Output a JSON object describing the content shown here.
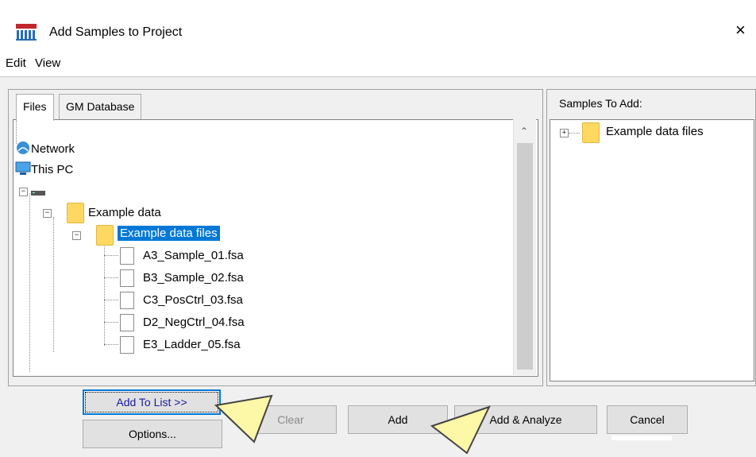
{
  "window": {
    "title": "Add Samples to Project",
    "close_glyph": "×",
    "icon": "gene-mapper-icon"
  },
  "menu": [
    {
      "label": "Edit"
    },
    {
      "label": "View"
    }
  ],
  "tabs": [
    {
      "label": "Files",
      "active": true
    },
    {
      "label": "GM Database",
      "active": false
    }
  ],
  "tree": {
    "network": "Network",
    "this_pc": "This PC",
    "folder1": "Example data",
    "folder2": "Example data files",
    "files": [
      "A3_Sample_01.fsa",
      "B3_Sample_02.fsa",
      "C3_PosCtrl_03.fsa",
      "D2_NegCtrl_04.fsa",
      "E3_Ladder_05.fsa"
    ]
  },
  "samples": {
    "group_label": "Samples To Add:",
    "items": [
      "Example data files"
    ]
  },
  "buttons": {
    "add_to_list": "Add To List >>",
    "options": "Options...",
    "clear": "Clear",
    "add": "Add",
    "add_analyze": "Add & Analyze",
    "cancel": "Cancel"
  },
  "colors": {
    "selection": "#0078d7",
    "folder": "#ffd862",
    "window_bg": "#f0f0f0"
  }
}
